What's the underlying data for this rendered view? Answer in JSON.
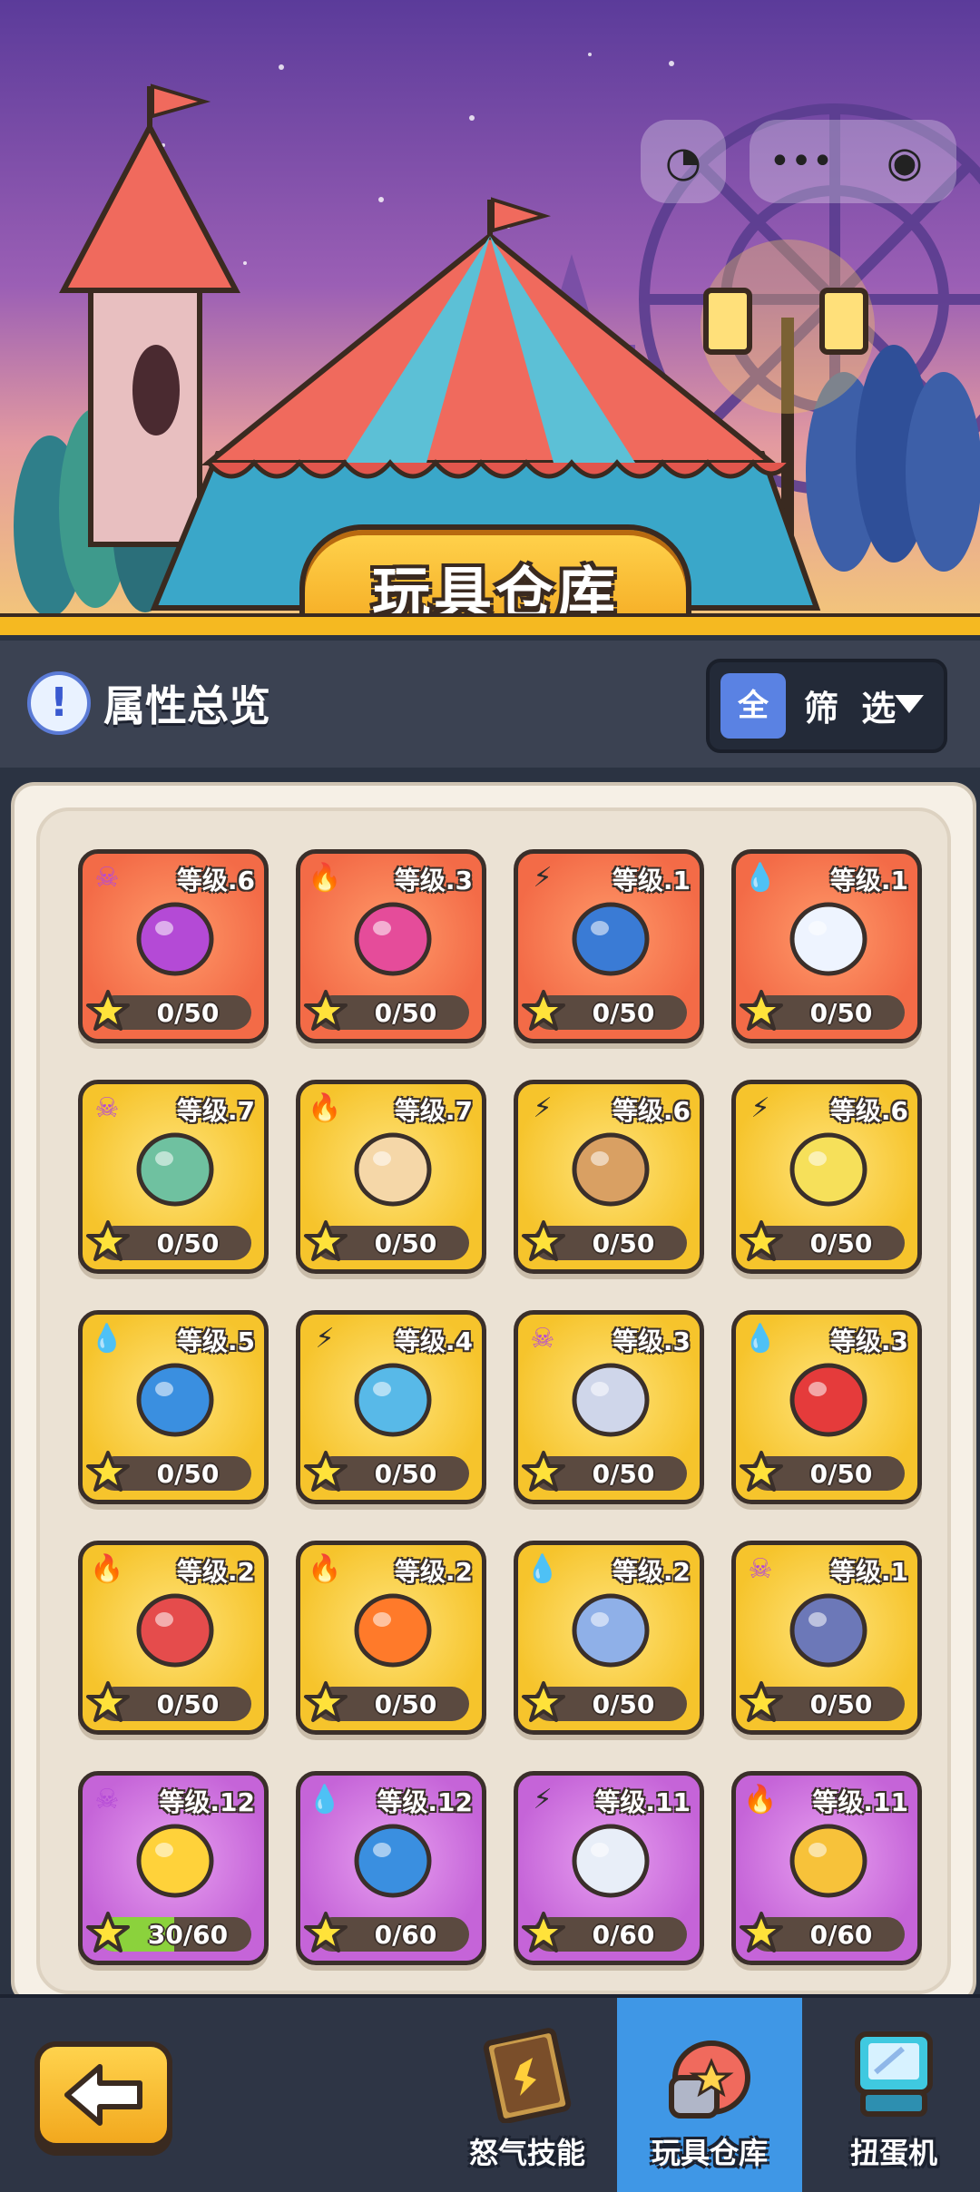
{
  "banner": {
    "title": "玩具仓库"
  },
  "header": {
    "overview_label": "属性总览",
    "filter_all": "全",
    "filter_label": "筛 选"
  },
  "grid": {
    "items": [
      {
        "element": "skull",
        "level": "等级.6",
        "progress": "0/50",
        "fraction": 0,
        "rarity": "red",
        "toy": "eye-compass"
      },
      {
        "element": "fire",
        "level": "等级.3",
        "progress": "0/50",
        "fraction": 0,
        "rarity": "red",
        "toy": "dragon-fruit"
      },
      {
        "element": "bolt",
        "level": "等级.1",
        "progress": "0/50",
        "fraction": 0,
        "rarity": "red",
        "toy": "blue-can-monster"
      },
      {
        "element": "drop",
        "level": "等级.1",
        "progress": "0/50",
        "fraction": 0,
        "rarity": "red",
        "toy": "snowman"
      },
      {
        "element": "skull",
        "level": "等级.7",
        "progress": "0/50",
        "fraction": 0,
        "rarity": "yellow",
        "toy": "treasure-map"
      },
      {
        "element": "fire",
        "level": "等级.7",
        "progress": "0/50",
        "fraction": 0,
        "rarity": "yellow",
        "toy": "fire-scroll"
      },
      {
        "element": "bolt",
        "level": "等级.6",
        "progress": "0/50",
        "fraction": 0,
        "rarity": "yellow",
        "toy": "teddy-bear"
      },
      {
        "element": "bolt",
        "level": "等级.6",
        "progress": "0/50",
        "fraction": 0,
        "rarity": "yellow",
        "toy": "bananas"
      },
      {
        "element": "drop",
        "level": "等级.5",
        "progress": "0/50",
        "fraction": 0,
        "rarity": "yellow",
        "toy": "water-jar"
      },
      {
        "element": "bolt",
        "level": "等级.4",
        "progress": "0/50",
        "fraction": 0,
        "rarity": "yellow",
        "toy": "lightning-card"
      },
      {
        "element": "skull",
        "level": "等级.3",
        "progress": "0/50",
        "fraction": 0,
        "rarity": "yellow",
        "toy": "sword"
      },
      {
        "element": "drop",
        "level": "等级.3",
        "progress": "0/50",
        "fraction": 0,
        "rarity": "yellow",
        "toy": "red-shoes"
      },
      {
        "element": "fire",
        "level": "等级.2",
        "progress": "0/50",
        "fraction": 0,
        "rarity": "yellow",
        "toy": "dart-target"
      },
      {
        "element": "fire",
        "level": "等级.2",
        "progress": "0/50",
        "fraction": 0,
        "rarity": "yellow",
        "toy": "fire-potion"
      },
      {
        "element": "drop",
        "level": "等级.2",
        "progress": "0/50",
        "fraction": 0,
        "rarity": "yellow",
        "toy": "penguin"
      },
      {
        "element": "skull",
        "level": "等级.1",
        "progress": "0/50",
        "fraction": 0,
        "rarity": "yellow",
        "toy": "helmet"
      },
      {
        "element": "skull",
        "level": "等级.12",
        "progress": "30/60",
        "fraction": 0.5,
        "rarity": "purple",
        "toy": "spiky-ball"
      },
      {
        "element": "drop",
        "level": "等级.12",
        "progress": "0/60",
        "fraction": 0,
        "rarity": "purple",
        "toy": "amulet"
      },
      {
        "element": "bolt",
        "level": "等级.11",
        "progress": "0/60",
        "fraction": 0,
        "rarity": "purple",
        "toy": "hourglass"
      },
      {
        "element": "fire",
        "level": "等级.11",
        "progress": "0/60",
        "fraction": 0,
        "rarity": "purple",
        "toy": "acorn"
      }
    ]
  },
  "bottom_nav": {
    "tabs": [
      {
        "label": "怒气技能",
        "icon": "rage-book-icon",
        "active": false
      },
      {
        "label": "玩具仓库",
        "icon": "toy-warehouse-icon",
        "active": true
      },
      {
        "label": "扭蛋机",
        "icon": "gacha-machine-icon",
        "active": false
      }
    ]
  },
  "colors": {
    "accent": "#f5b921",
    "active_tab": "#3f97e6",
    "rarity_red": "#f36b47",
    "rarity_yellow": "#f6c42c",
    "rarity_purple": "#c564d8"
  }
}
